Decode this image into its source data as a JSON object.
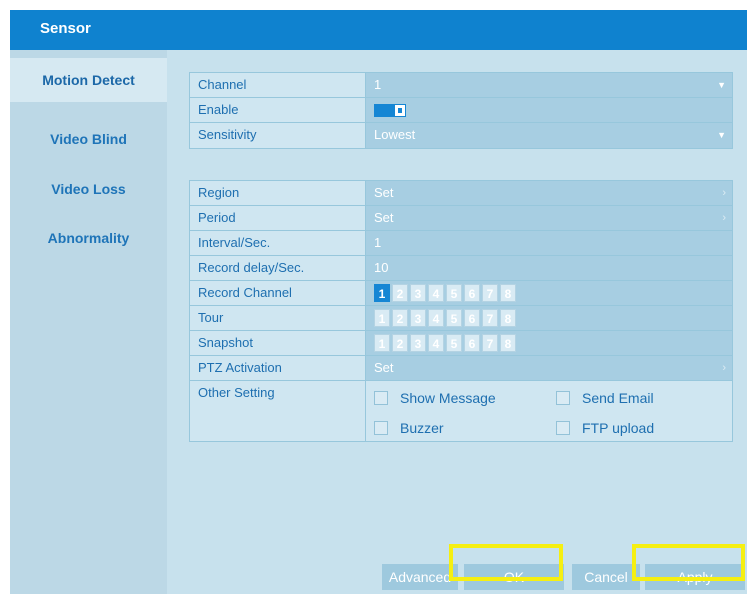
{
  "window": {
    "title": "Sensor"
  },
  "sidebar": {
    "items": [
      {
        "label": "Motion Detect",
        "active": true
      },
      {
        "label": "Video Blind",
        "active": false
      },
      {
        "label": "Video Loss",
        "active": false
      },
      {
        "label": "Abnormality",
        "active": false
      }
    ]
  },
  "settings": {
    "channel": {
      "label": "Channel",
      "value": "1"
    },
    "enable": {
      "label": "Enable",
      "value": "on"
    },
    "sensitivity": {
      "label": "Sensitivity",
      "value": "Lowest"
    },
    "region": {
      "label": "Region",
      "value": "Set"
    },
    "period": {
      "label": "Period",
      "value": "Set"
    },
    "interval": {
      "label": "Interval/Sec.",
      "value": "1"
    },
    "record_delay": {
      "label": "Record delay/Sec.",
      "value": "10"
    },
    "record_channel": {
      "label": "Record Channel",
      "channels": [
        "1",
        "2",
        "3",
        "4",
        "5",
        "6",
        "7",
        "8"
      ],
      "selected": [
        "1"
      ]
    },
    "tour": {
      "label": "Tour",
      "channels": [
        "1",
        "2",
        "3",
        "4",
        "5",
        "6",
        "7",
        "8"
      ],
      "selected": []
    },
    "snapshot": {
      "label": "Snapshot",
      "channels": [
        "1",
        "2",
        "3",
        "4",
        "5",
        "6",
        "7",
        "8"
      ],
      "selected": []
    },
    "ptz": {
      "label": "PTZ Activation",
      "value": "Set"
    },
    "other": {
      "label": "Other Setting",
      "show_message": "Show Message",
      "send_email": "Send Email",
      "buzzer": "Buzzer",
      "ftp_upload": "FTP upload"
    }
  },
  "buttons": {
    "advanced": "Advanced",
    "ok": "OK",
    "cancel": "Cancel",
    "apply": "Apply"
  },
  "colors": {
    "titlebar": "#0f82cf",
    "accent": "#1586d4",
    "highlight": "#f5ef12"
  }
}
